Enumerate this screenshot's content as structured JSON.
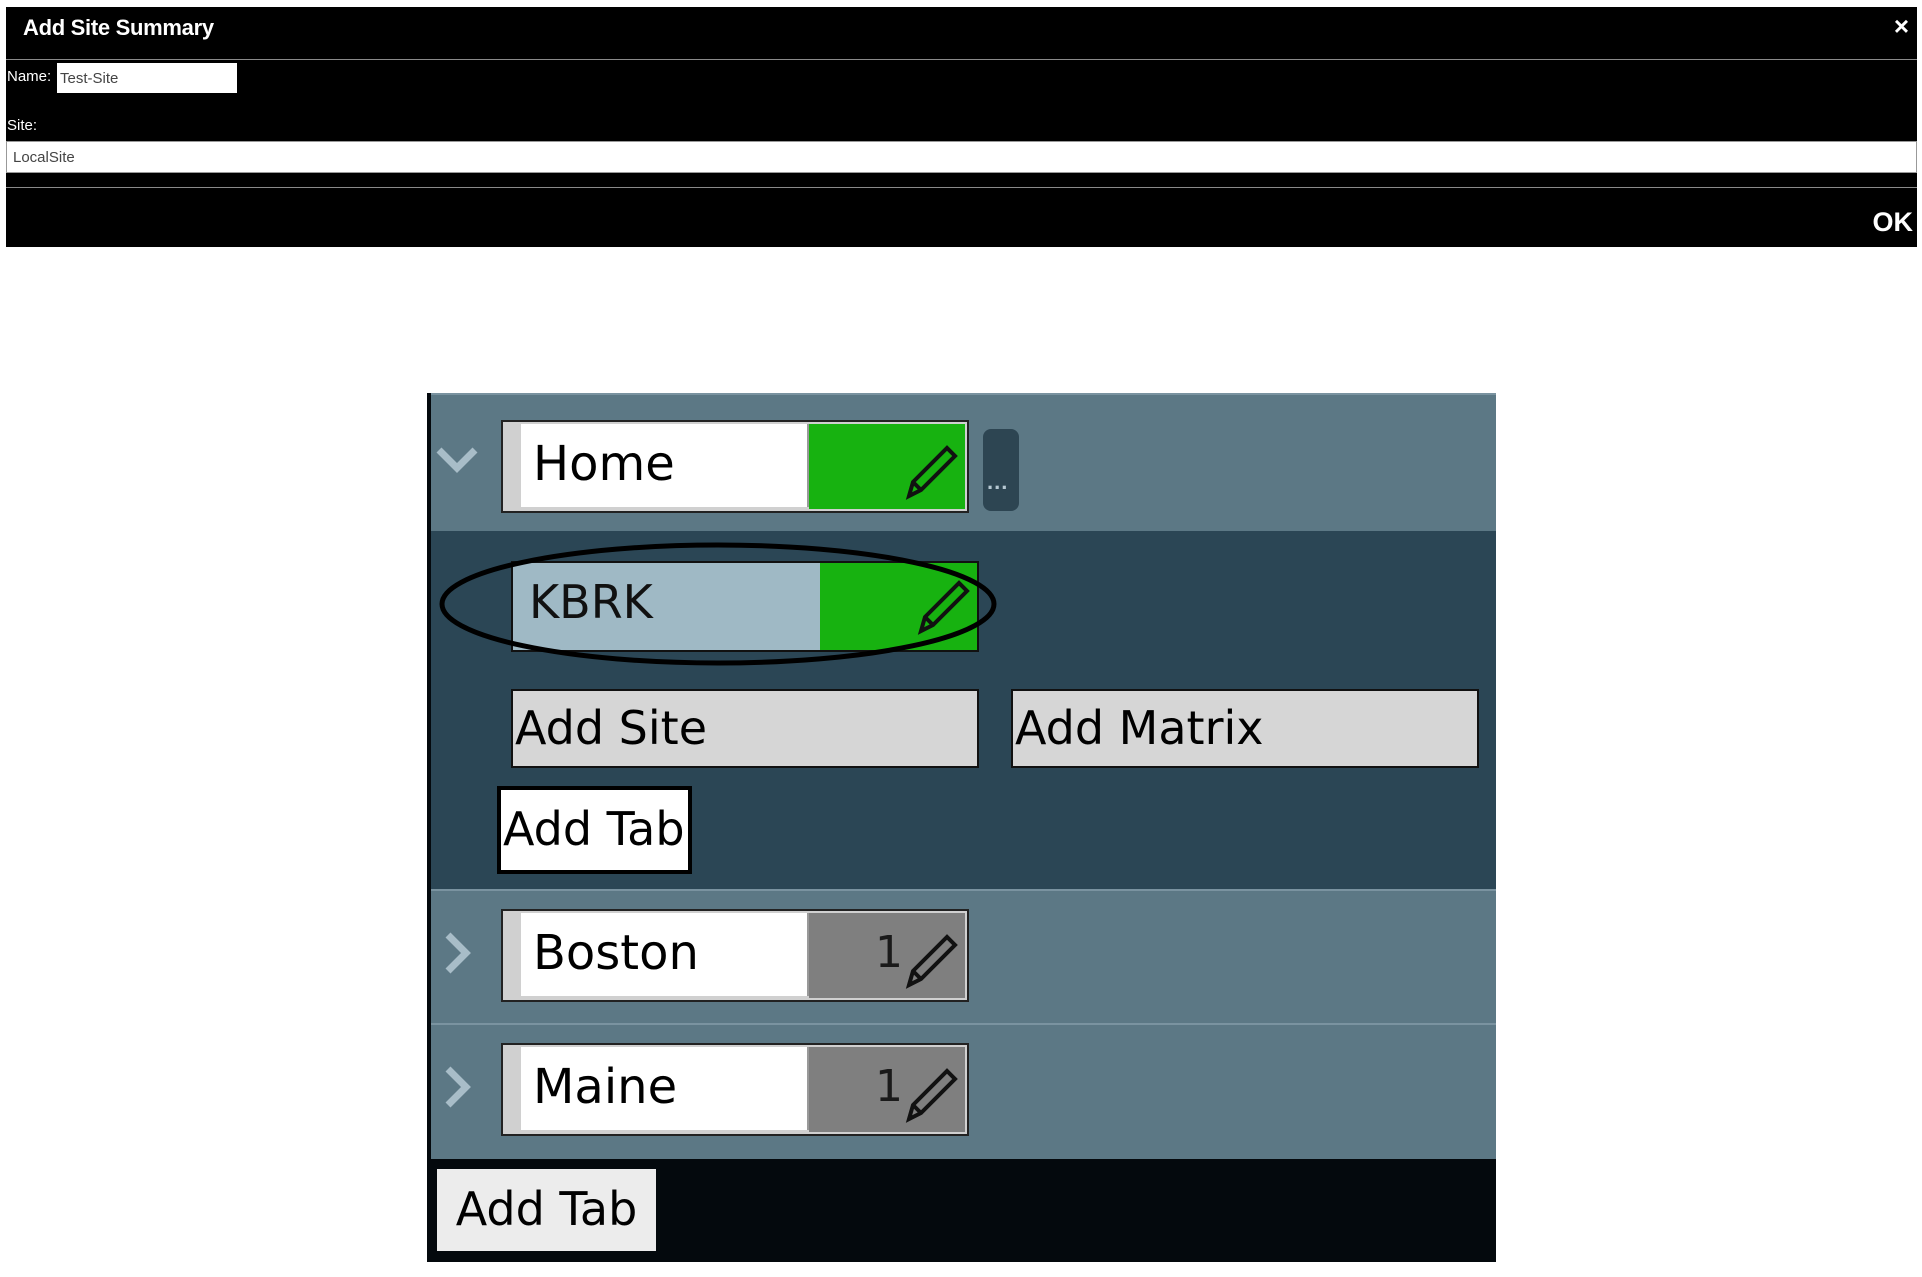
{
  "dialog": {
    "title": "Add Site Summary",
    "close_glyph": "×",
    "name_label": "Name:",
    "name_value": "Test-Site",
    "site_label": "Site:",
    "site_value": "LocalSite",
    "ok_label": "OK"
  },
  "tree": {
    "home": {
      "label": "Home",
      "status_color": "#17b210",
      "more_label": "...",
      "children": {
        "site": {
          "label": "KBRK",
          "status_color": "#17b210"
        },
        "add_site_label": "Add Site",
        "add_matrix_label": "Add Matrix",
        "add_tab_label": "Add Tab"
      }
    },
    "rows": [
      {
        "label": "Boston",
        "count": "1",
        "status_color": "#7f7f7f"
      },
      {
        "label": "Maine",
        "count": "1",
        "status_color": "#7f7f7f"
      }
    ],
    "add_tab_label": "Add Tab"
  },
  "icons": {
    "chevron_expanded": "chevron-down-icon",
    "chevron_collapsed": "chevron-right-icon",
    "edit": "pencil-icon"
  },
  "colors": {
    "panel_row": "#5c7885",
    "panel_expanded": "#2b4655",
    "ok_green": "#17b210",
    "neutral_gray": "#7f7f7f"
  }
}
